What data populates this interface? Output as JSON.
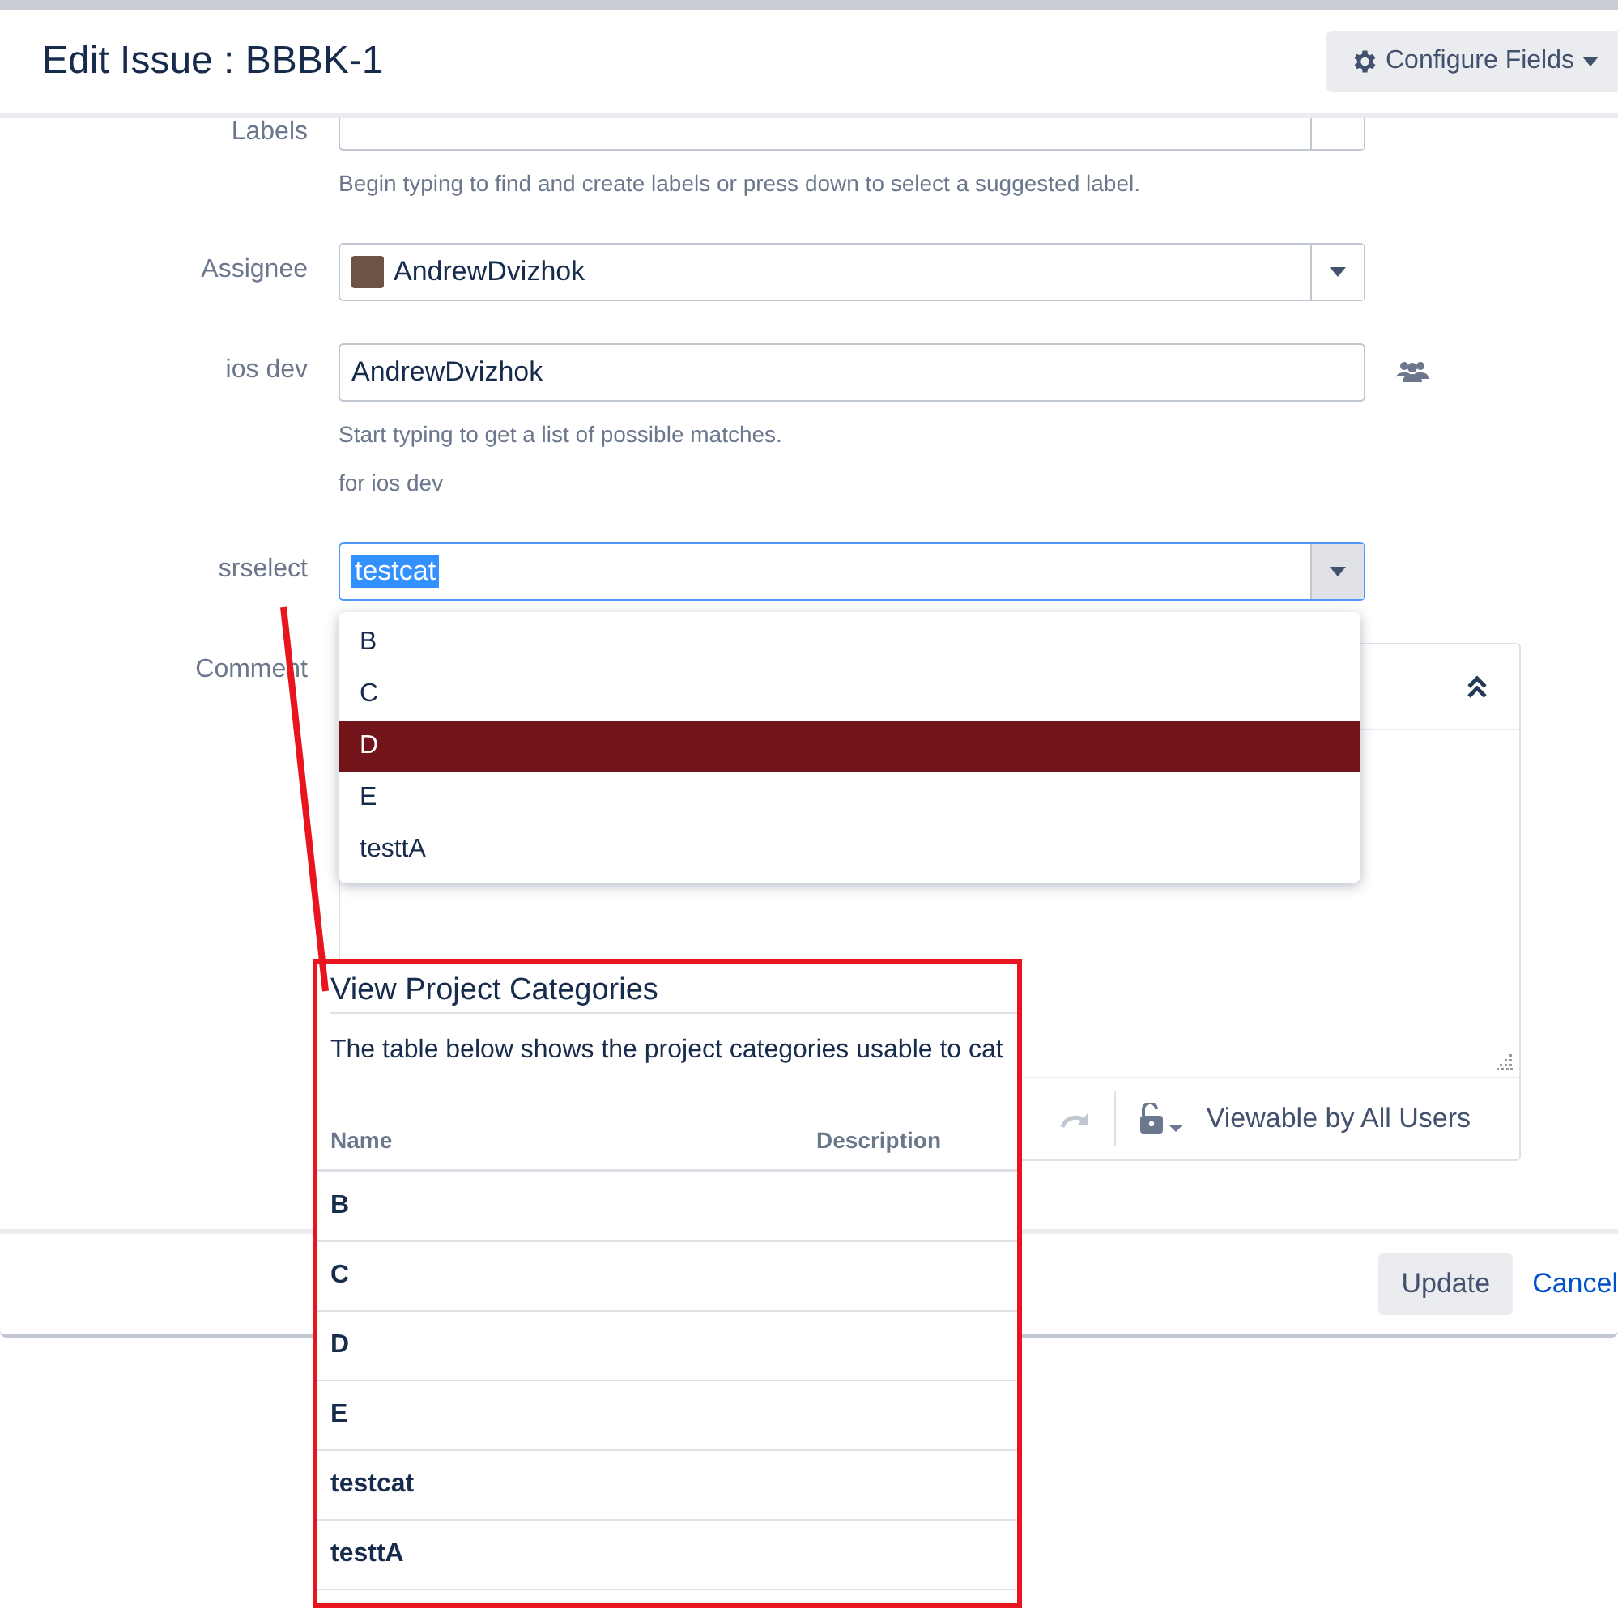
{
  "dialog": {
    "title": "Edit Issue : BBBK-1",
    "configure_button": "Configure Fields"
  },
  "fields": [
    {
      "kind": "text",
      "label": "Labels",
      "help": [
        "Begin typing to find and create labels or press down to select a suggested label."
      ]
    },
    {
      "kind": "user-select",
      "label": "Assignee",
      "value": "AndrewDvizhok"
    },
    {
      "kind": "user-picker",
      "label": "ios dev",
      "value": "AndrewDvizhok",
      "help": [
        "Start typing to get a list of possible matches.",
        "for ios dev"
      ]
    },
    {
      "kind": "select",
      "label": "srselect",
      "value": "testcat",
      "focused": true
    }
  ],
  "dropdown": {
    "options": [
      {
        "label": "B",
        "selected": false
      },
      {
        "label": "C",
        "selected": false
      },
      {
        "label": "D",
        "selected": true
      },
      {
        "label": "E",
        "selected": false
      },
      {
        "label": "testtA",
        "selected": false
      }
    ]
  },
  "comment": {
    "label": "Comment",
    "visibility": "Viewable by All Users"
  },
  "footer": {
    "buttons": [
      {
        "kind": "primary",
        "label": "Update"
      },
      {
        "kind": "link",
        "label": "Cancel"
      }
    ]
  },
  "callout": {
    "title": "View Project Categories",
    "description": "The table below shows the project categories usable to cat",
    "columns": [
      "Name",
      "Description"
    ],
    "rows": [
      {
        "name": "B"
      },
      {
        "name": "C"
      },
      {
        "name": "D"
      },
      {
        "name": "E"
      },
      {
        "name": "testcat"
      },
      {
        "name": "testtA"
      }
    ]
  }
}
